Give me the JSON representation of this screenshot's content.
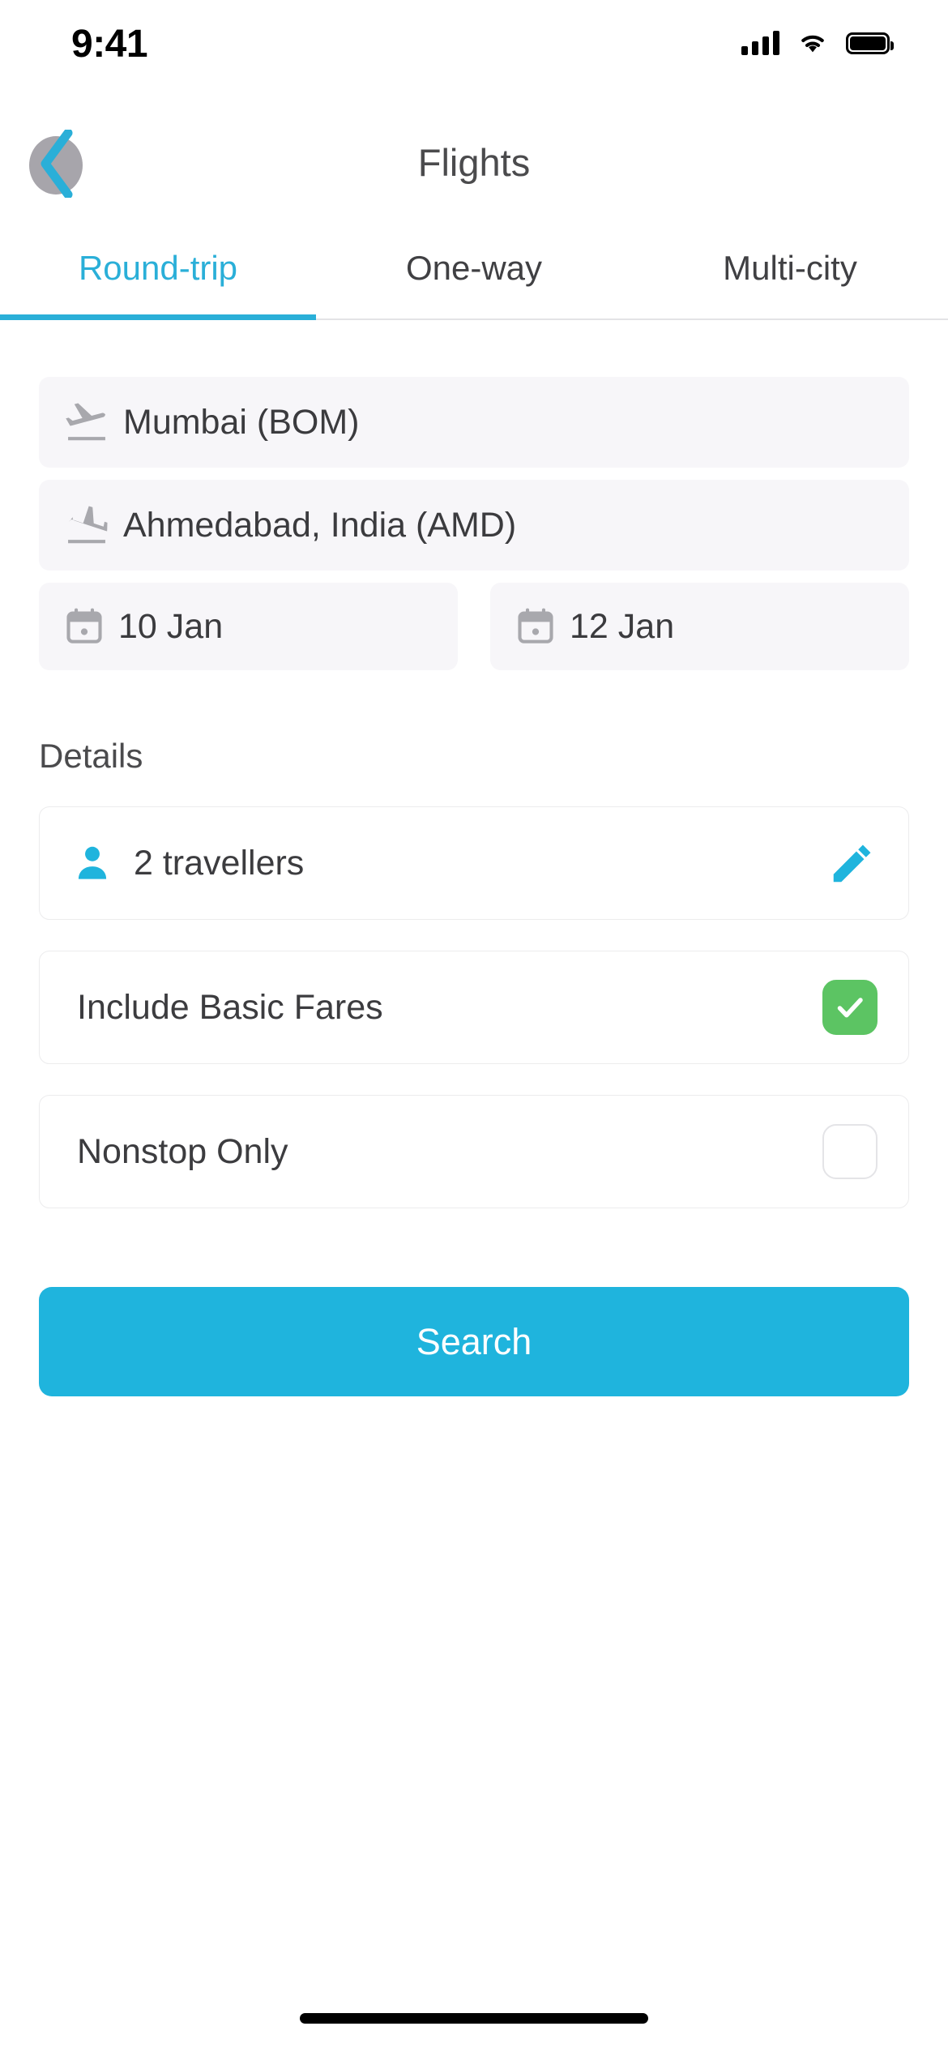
{
  "status_bar": {
    "time": "9:41",
    "signal_icon": "cellular-signal-icon",
    "wifi_icon": "wifi-icon",
    "battery_icon": "battery-full-icon"
  },
  "nav": {
    "back_icon": "back-chevron-icon",
    "title": "Flights"
  },
  "tabs": [
    {
      "label": "Round-trip",
      "active": true
    },
    {
      "label": "One-way",
      "active": false
    },
    {
      "label": "Multi-city",
      "active": false
    }
  ],
  "search_form": {
    "origin": {
      "icon": "flight-takeoff-icon",
      "value": "Mumbai (BOM)"
    },
    "destination": {
      "icon": "flight-land-icon",
      "value": "Ahmedabad, India (AMD)"
    },
    "depart_date": {
      "icon": "calendar-icon",
      "value": "10 Jan"
    },
    "return_date": {
      "icon": "calendar-icon",
      "value": "12 Jan"
    }
  },
  "details": {
    "heading": "Details",
    "travellers": {
      "icon": "person-icon",
      "label": "2 travellers",
      "edit_icon": "pencil-edit-icon"
    },
    "options": [
      {
        "label": "Include Basic Fares",
        "checked": true
      },
      {
        "label": "Nonstop Only",
        "checked": false
      }
    ]
  },
  "search_button": {
    "label": "Search"
  },
  "colors": {
    "accent": "#1fb4dd",
    "tab_active": "#2aafd8",
    "checkbox_checked": "#5cc463",
    "field_background": "#f7f6f9",
    "text_primary": "#3b3b3e"
  }
}
